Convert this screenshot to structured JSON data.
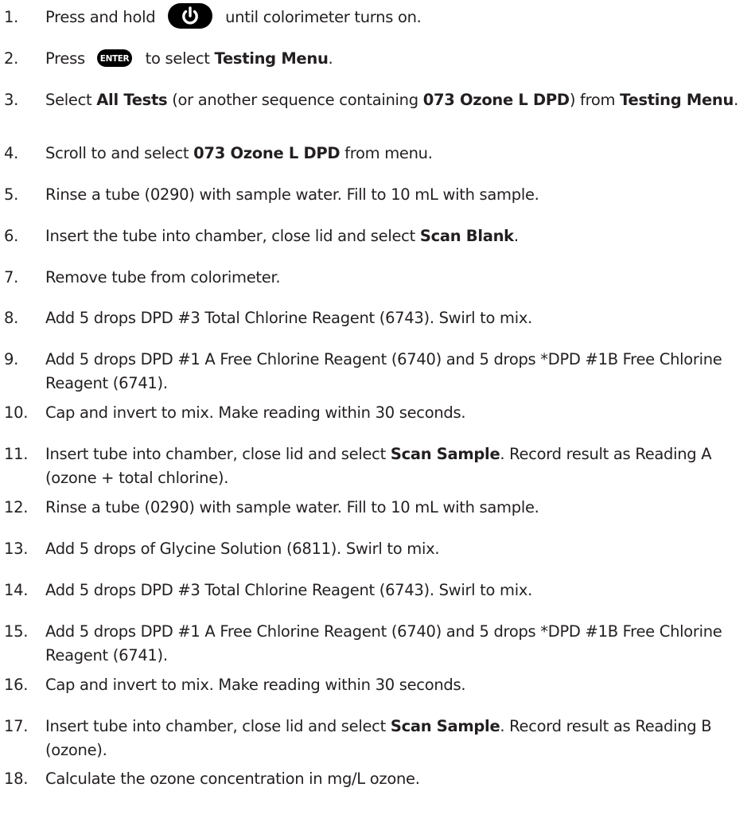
{
  "colors": {
    "text": "#231f20",
    "icon_fill": "#000000",
    "icon_glyph": "#ffffff"
  },
  "icons": {
    "power": "power-button-icon",
    "enter": "enter-button-icon",
    "enter_label": "ENTER"
  },
  "steps": [
    {
      "number": "1.",
      "parts": [
        {
          "t": "Press and hold "
        },
        {
          "icon": "power"
        },
        {
          "t": " until colorimeter turns on."
        }
      ]
    },
    {
      "number": "2.",
      "parts": [
        {
          "t": "Press "
        },
        {
          "icon": "enter"
        },
        {
          "t": " to select "
        },
        {
          "t": "Testing Menu",
          "b": true
        },
        {
          "t": "."
        }
      ]
    },
    {
      "number": "3.",
      "parts": [
        {
          "t": "Select "
        },
        {
          "t": "All Tests",
          "b": true
        },
        {
          "t": " (or another sequence containing "
        },
        {
          "t": "073 Ozone L DPD",
          "b": true
        },
        {
          "t": ") from "
        },
        {
          "t": "Testing Menu",
          "b": true
        },
        {
          "t": "."
        }
      ]
    },
    {
      "number": "4.",
      "parts": [
        {
          "t": "Scroll to and select "
        },
        {
          "t": "073 Ozone L DPD",
          "b": true
        },
        {
          "t": " from menu."
        }
      ]
    },
    {
      "number": "5.",
      "parts": [
        {
          "t": "Rinse a tube (0290) with sample water. Fill to 10 mL with sample."
        }
      ]
    },
    {
      "number": "6.",
      "parts": [
        {
          "t": "Insert the tube into chamber, close lid and select "
        },
        {
          "t": "Scan Blank",
          "b": true
        },
        {
          "t": "."
        }
      ]
    },
    {
      "number": "7.",
      "parts": [
        {
          "t": "Remove tube from colorimeter."
        }
      ]
    },
    {
      "number": "8.",
      "parts": [
        {
          "t": "Add 5 drops DPD #3 Total Chlorine Reagent (6743). Swirl to mix."
        }
      ]
    },
    {
      "number": "9.",
      "parts": [
        {
          "t": "Add 5 drops DPD #1 A Free Chlorine Reagent (6740) and 5 drops *DPD #1B Free Chlorine Reagent (6741)."
        }
      ]
    },
    {
      "number": "10.",
      "parts": [
        {
          "t": "Cap and invert to mix. Make reading within 30 seconds."
        }
      ]
    },
    {
      "number": "11.",
      "parts": [
        {
          "t": "Insert tube into chamber, close lid and select "
        },
        {
          "t": "Scan Sample",
          "b": true
        },
        {
          "t": ". Record result as Reading A (ozone + total chlorine)."
        }
      ]
    },
    {
      "number": "12.",
      "parts": [
        {
          "t": "Rinse a tube (0290) with sample water. Fill to 10 mL with sample."
        }
      ]
    },
    {
      "number": "13.",
      "parts": [
        {
          "t": "Add 5 drops of Glycine Solution (6811). Swirl to mix."
        }
      ]
    },
    {
      "number": "14.",
      "parts": [
        {
          "t": "Add 5 drops DPD #3 Total Chlorine Reagent (6743). Swirl to mix."
        }
      ]
    },
    {
      "number": "15.",
      "parts": [
        {
          "t": "Add 5 drops DPD #1 A Free Chlorine Reagent (6740) and 5 drops *DPD #1B Free Chlorine Reagent (6741)."
        }
      ]
    },
    {
      "number": "16.",
      "parts": [
        {
          "t": "Cap and invert to mix. Make reading within 30 seconds."
        }
      ]
    },
    {
      "number": "17.",
      "parts": [
        {
          "t": "Insert tube into chamber, close lid and select "
        },
        {
          "t": "Scan Sample",
          "b": true
        },
        {
          "t": ". Record result as Reading B (ozone)."
        }
      ]
    },
    {
      "number": "18.",
      "parts": [
        {
          "t": "Calculate the ozone concentration in mg/L ozone."
        }
      ]
    }
  ]
}
